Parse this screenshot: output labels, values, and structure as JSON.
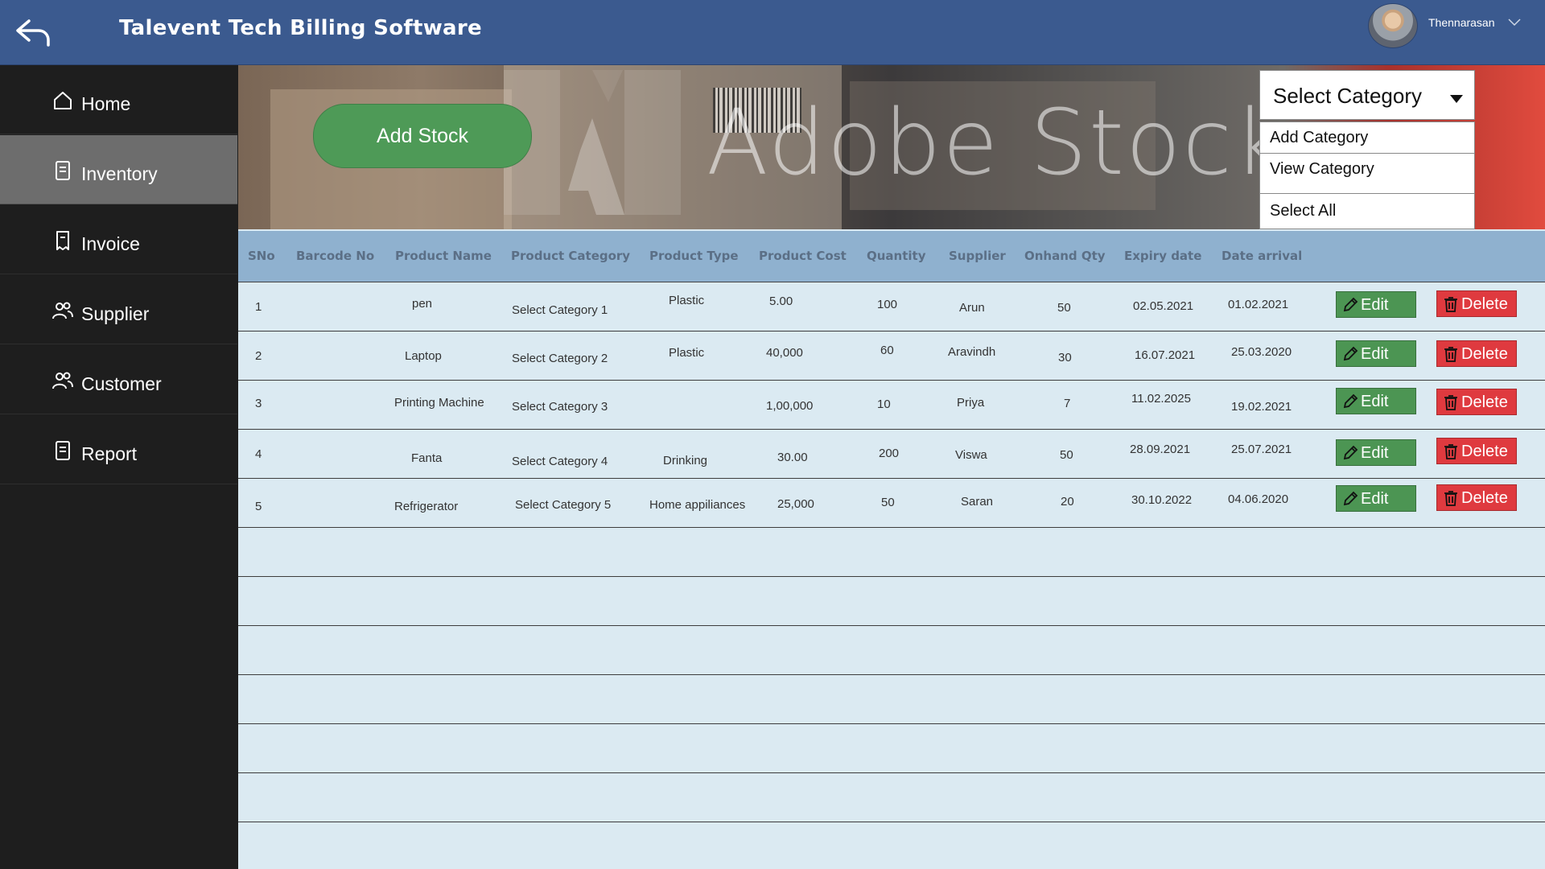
{
  "header": {
    "title": "Talevent Tech Billing Software",
    "user_name": "Thennarasan"
  },
  "sidebar": {
    "items": [
      {
        "label": "Home",
        "icon": "home-icon"
      },
      {
        "label": "Inventory",
        "icon": "document-icon",
        "active": true
      },
      {
        "label": "Invoice",
        "icon": "receipt-icon"
      },
      {
        "label": "Supplier",
        "icon": "people-icon"
      },
      {
        "label": "Customer",
        "icon": "people-icon"
      },
      {
        "label": "Report",
        "icon": "document-icon"
      }
    ]
  },
  "banner": {
    "watermark": "Adobe Stock",
    "add_stock_label": "Add Stock"
  },
  "category": {
    "selected": "Select Category",
    "options": [
      "Add Category",
      "View Category",
      "Select All"
    ]
  },
  "table": {
    "headers": [
      "SNo",
      "Barcode No",
      "Product Name",
      "Product Category",
      "Product Type",
      "Product Cost",
      "Quantity",
      "Supplier",
      "Onhand Qty",
      "Expiry date",
      "Date arrival"
    ],
    "rows": [
      {
        "sno": "1",
        "barcode": "",
        "name": "pen",
        "category": "Select Category 1",
        "type": "Plastic",
        "cost": "5.00",
        "qty": "100",
        "supplier": "Arun",
        "onhand": "50",
        "expiry": "02.05.2021",
        "arrival": "01.02.2021"
      },
      {
        "sno": "2",
        "barcode": "",
        "name": "Laptop",
        "category": "Select Category 2",
        "type": "Plastic",
        "cost": "40,000",
        "qty": "60",
        "supplier": "Aravindh",
        "onhand": "30",
        "expiry": "16.07.2021",
        "arrival": "25.03.2020"
      },
      {
        "sno": "3",
        "barcode": "",
        "name": "Printing Machine",
        "category": "Select Category 3",
        "type": "",
        "cost": "1,00,000",
        "qty": "10",
        "supplier": "Priya",
        "onhand": "7",
        "expiry": "11.02.2025",
        "arrival": "19.02.2021"
      },
      {
        "sno": "4",
        "barcode": "",
        "name": "Fanta",
        "category": "Select Category 4",
        "type": "Drinking",
        "cost": "30.00",
        "qty": "200",
        "supplier": "Viswa",
        "onhand": "50",
        "expiry": "28.09.2021",
        "arrival": "25.07.2021"
      },
      {
        "sno": "5",
        "barcode": "",
        "name": "Refrigerator",
        "category": "Select Category 5",
        "type": "Home appiliances",
        "cost": "25,000",
        "qty": "50",
        "supplier": "Saran",
        "onhand": "20",
        "expiry": "30.10.2022",
        "arrival": "04.06.2020"
      }
    ],
    "edit_label": "Edit",
    "delete_label": "Delete"
  },
  "colors": {
    "header_bg": "#3b5a8f",
    "sidebar_bg": "#1e1e1e",
    "active_nav": "#6d6d6d",
    "table_bg": "#dbeaf2",
    "table_header_bg": "#8fb1cf",
    "add_stock": "#4e9a57",
    "edit": "#4c9553",
    "delete": "#df3a3f"
  }
}
